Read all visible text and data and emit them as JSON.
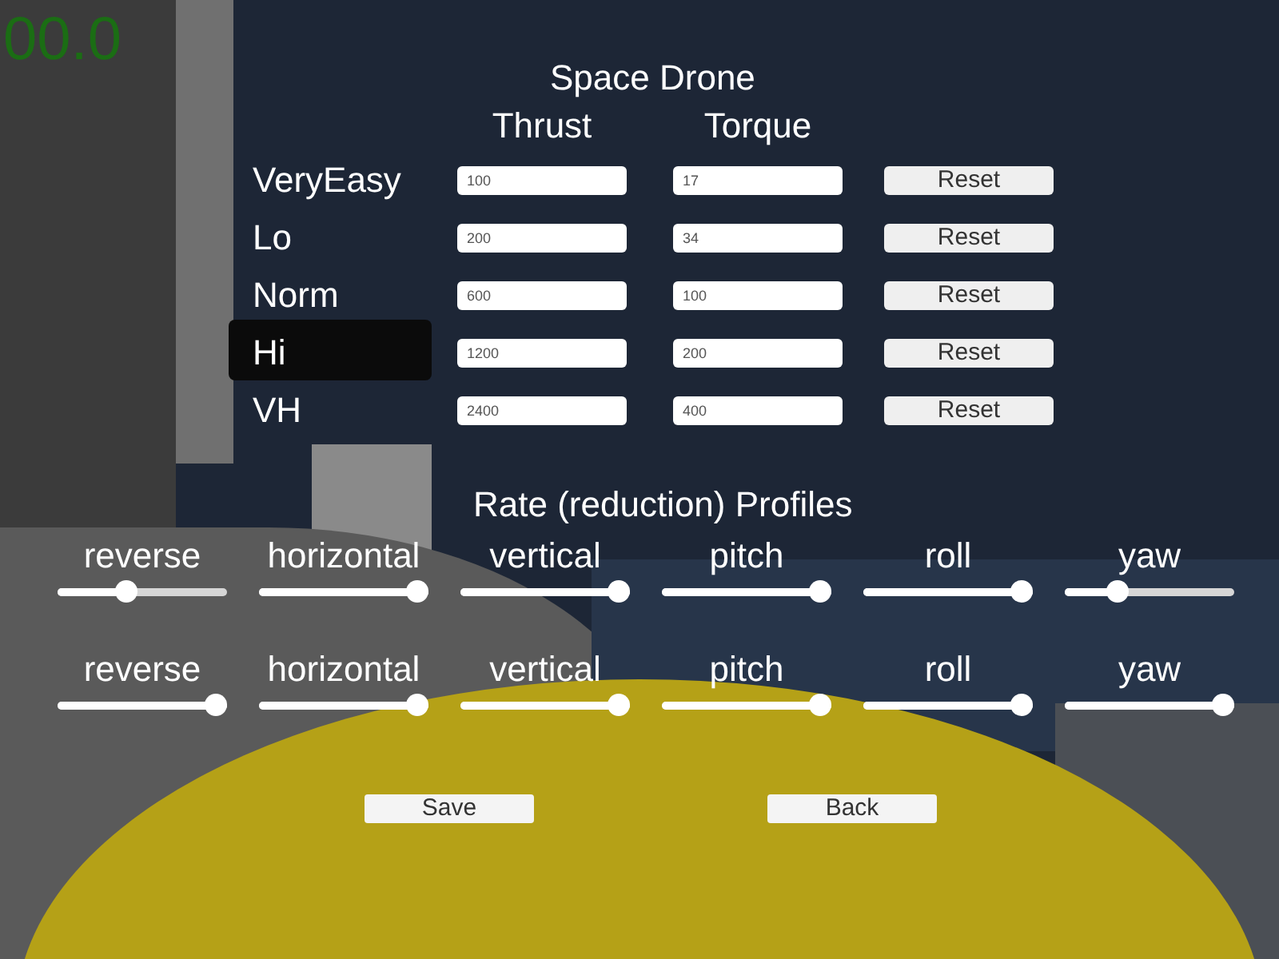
{
  "hud": {
    "timer": "00.0"
  },
  "title": "Space Drone",
  "columns": [
    "Thrust",
    "Torque"
  ],
  "profiles": [
    {
      "label": "VeryEasy",
      "thrust": "100",
      "torque": "17",
      "reset": "Reset"
    },
    {
      "label": "Lo",
      "thrust": "200",
      "torque": "34",
      "reset": "Reset"
    },
    {
      "label": "Norm",
      "thrust": "600",
      "torque": "100",
      "reset": "Reset"
    },
    {
      "label": "Hi",
      "thrust": "1200",
      "torque": "200",
      "reset": "Reset"
    },
    {
      "label": "VH",
      "thrust": "2400",
      "torque": "400",
      "reset": "Reset"
    }
  ],
  "rates": {
    "title": "Rate (reduction) Profiles",
    "rows": [
      {
        "sliders": [
          {
            "label": "reverse",
            "level": 0.39
          },
          {
            "label": "horizontal",
            "level": 1
          },
          {
            "label": "vertical",
            "level": 1
          },
          {
            "label": "pitch",
            "level": 1
          },
          {
            "label": "roll",
            "level": 1
          },
          {
            "label": "yaw",
            "level": 0.28
          }
        ]
      },
      {
        "sliders": [
          {
            "label": "reverse",
            "level": 1
          },
          {
            "label": "horizontal",
            "level": 1
          },
          {
            "label": "vertical",
            "level": 1
          },
          {
            "label": "pitch",
            "level": 1
          },
          {
            "label": "roll",
            "level": 1
          },
          {
            "label": "yaw",
            "level": 1
          }
        ]
      }
    ]
  },
  "buttons": [
    {
      "label": "Save"
    },
    {
      "label": "Back"
    }
  ]
}
